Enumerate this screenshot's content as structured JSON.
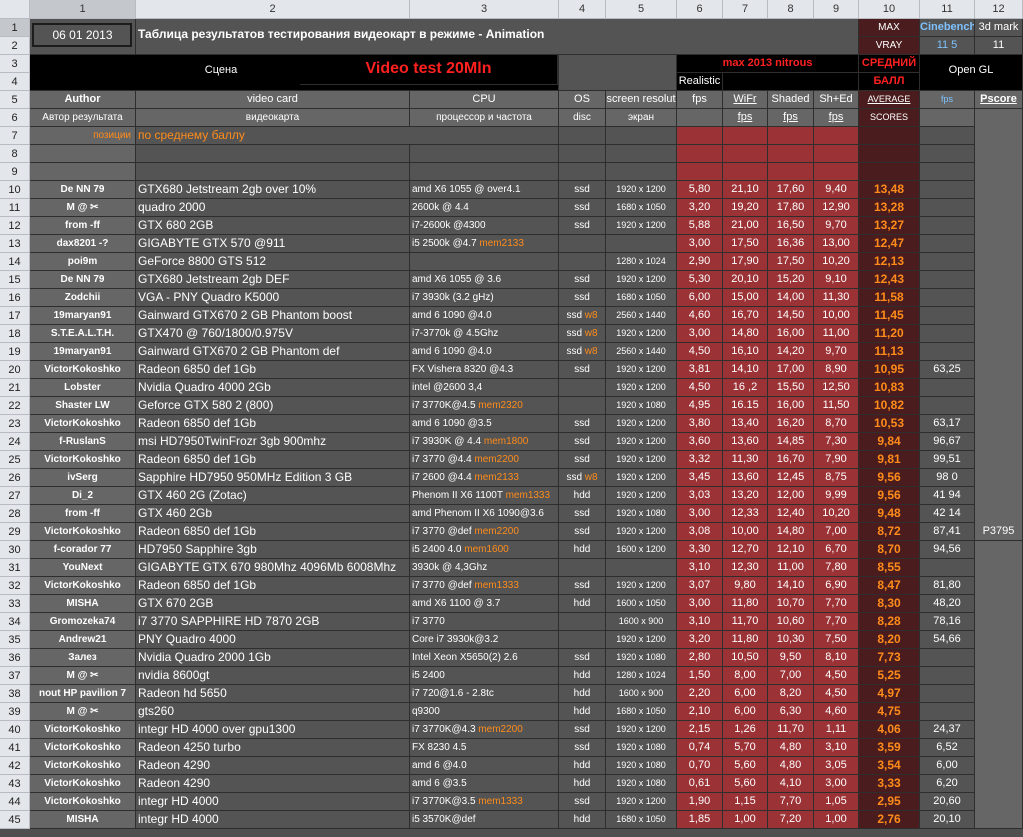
{
  "column_headers": [
    "1",
    "2",
    "3",
    "4",
    "5",
    "6",
    "7",
    "8",
    "9",
    "10",
    "11",
    "12"
  ],
  "row_numbers": [
    "1",
    "2",
    "3",
    "4",
    "5",
    "6",
    "7",
    "8",
    "9",
    "10",
    "11",
    "12",
    "13",
    "14",
    "15",
    "16",
    "17",
    "18",
    "19",
    "20",
    "21",
    "22",
    "23",
    "24",
    "25",
    "26",
    "27",
    "28",
    "29",
    "30",
    "31",
    "32",
    "33",
    "34",
    "35",
    "36",
    "37",
    "38",
    "39",
    "40",
    "41",
    "42",
    "43",
    "44",
    "45"
  ],
  "header": {
    "date": "06 01 2013",
    "title": "Таблица результатов тестирования видеокарт в режиме - Animation",
    "max_vray_1": "MAX",
    "max_vray_2": "VRAY",
    "cinebench_1": "Cinebench",
    "cinebench_2": "11 5",
    "mark3d_1": "3d mark",
    "mark3d_2": "11",
    "scene": "Сцена",
    "video_test": "Video test 20Mln",
    "max2013": "max 2013 nitrous",
    "avg_score_1": "СРЕДНИЙ",
    "avg_score_2": "БАЛЛ",
    "opengl": "Open GL",
    "realistic": "Realistic",
    "author": "Author",
    "video_card": "video card",
    "cpu": "CPU",
    "os": "OS",
    "screen_res": "screen resolut",
    "fps": "fps",
    "wifr": "WiFr",
    "shaded": "Shaded",
    "sh_ed": "Sh+Ed",
    "average": "AVERAGE",
    "fps11": "fps",
    "pscore": "Pscore",
    "author_ru": "Автор результата",
    "video_card_ru": "видеокарта",
    "cpu_ru": "процессор и частота",
    "disc": "disc",
    "screen_ru": "экран",
    "fps2": "fps",
    "fps3": "fps",
    "fps4": "fps",
    "scores": "SCORES",
    "positions": "позиции",
    "by_avg": "по среднему баллу"
  },
  "rows": [
    {
      "author": "De NN 79",
      "card": "GTX680 Jetstream 2gb over 10%",
      "cpu": "amd X6 1055 @ over4.1",
      "mem": "",
      "disc": "ssd",
      "w8": "",
      "res": "1920 x 1200",
      "real": "5,80",
      "wifr": "21,10",
      "shaded": "17,60",
      "shed": "9,40",
      "avg": "13,48",
      "cine": "",
      "pscore": ""
    },
    {
      "author": "M @ ✂",
      "card": "quadro 2000",
      "cpu": "2600k @ 4.4",
      "mem": "",
      "disc": "ssd",
      "w8": "",
      "res": "1680 x 1050",
      "real": "3,20",
      "wifr": "19,20",
      "shaded": "17,80",
      "shed": "12,90",
      "avg": "13,28",
      "cine": "",
      "pscore": ""
    },
    {
      "author": "from -ff",
      "card": "GTX 680 2GB",
      "cpu": "i7-2600k @4300",
      "mem": "",
      "disc": "ssd",
      "w8": "",
      "res": "1920 x 1200",
      "real": "5,88",
      "wifr": "21,00",
      "shaded": "16,50",
      "shed": "9,70",
      "avg": "13,27",
      "cine": "",
      "pscore": ""
    },
    {
      "author": "dax8201 -?",
      "card": "GIGABYTE GTX 570 @911",
      "cpu": "i5 2500k @4.7",
      "mem": "mem2133",
      "disc": "",
      "w8": "",
      "res": "",
      "real": "3,00",
      "wifr": "17,50",
      "shaded": "16,36",
      "shed": "13,00",
      "avg": "12,47",
      "cine": "",
      "pscore": ""
    },
    {
      "author": "poi9m",
      "card": "GeForce 8800 GTS 512",
      "cpu": "",
      "mem": "",
      "disc": "",
      "w8": "",
      "res": "1280 x 1024",
      "real": "2,90",
      "wifr": "17,90",
      "shaded": "17,50",
      "shed": "10,20",
      "avg": "12,13",
      "cine": "",
      "pscore": ""
    },
    {
      "author": "De NN 79",
      "card": "GTX680 Jetstream 2gb DEF",
      "cpu": "amd X6 1055 @ 3.6",
      "mem": "",
      "disc": "ssd",
      "w8": "",
      "res": "1920 x 1200",
      "real": "5,30",
      "wifr": "20,10",
      "shaded": "15,20",
      "shed": "9,10",
      "avg": "12,43",
      "cine": "",
      "pscore": ""
    },
    {
      "author": "Zodchii",
      "card": "VGA - PNY Quadro K5000",
      "cpu": "i7 3930k (3.2 gHz)",
      "mem": "",
      "disc": "ssd",
      "w8": "",
      "res": "1680 x 1050",
      "real": "6,00",
      "wifr": "15,00",
      "shaded": "14,00",
      "shed": "11,30",
      "avg": "11,58",
      "cine": "",
      "pscore": ""
    },
    {
      "author": "19maryan91",
      "card": "Gainward GTX670 2 GB Phantom boost",
      "cpu": "amd 6 1090 @4.0",
      "mem": "",
      "disc": "ssd",
      "w8": "w8",
      "res": "2560 x 1440",
      "real": "4,60",
      "wifr": "16,70",
      "shaded": "14,50",
      "shed": "10,00",
      "avg": "11,45",
      "cine": "",
      "pscore": ""
    },
    {
      "author": "S.T.E.A.L.T.H.",
      "card": "GTX470 @ 760/1800/0.975V",
      "cpu": "i7-3770k @ 4.5Ghz",
      "mem": "",
      "disc": "ssd",
      "w8": "w8",
      "res": "1920 x 1200",
      "real": "3,00",
      "wifr": "14,80",
      "shaded": "16,00",
      "shed": "11,00",
      "avg": "11,20",
      "cine": "",
      "pscore": ""
    },
    {
      "author": "19maryan91",
      "card": "Gainward GTX670 2 GB Phantom def",
      "cpu": "amd 6 1090 @4.0",
      "mem": "",
      "disc": "ssd",
      "w8": "w8",
      "res": "2560 x 1440",
      "real": "4,50",
      "wifr": "16,10",
      "shaded": "14,20",
      "shed": "9,70",
      "avg": "11,13",
      "cine": "",
      "pscore": ""
    },
    {
      "author": "VictorKokoshko",
      "card": "Radeon 6850 def 1Gb",
      "cpu": "FX Vishera 8320 @4.3",
      "mem": "",
      "disc": "ssd",
      "w8": "",
      "res": "1920 x 1200",
      "real": "3,81",
      "wifr": "14,10",
      "shaded": "17,00",
      "shed": "8,90",
      "avg": "10,95",
      "cine": "63,25",
      "pscore": ""
    },
    {
      "author": "Lobster",
      "card": "Nvidia Quadro 4000 2Gb",
      "cpu": "intel @2600 3,4",
      "mem": "",
      "disc": "",
      "w8": "",
      "res": "1920 x 1200",
      "real": "4,50",
      "wifr": "16 ,2",
      "shaded": "15,50",
      "shed": "12,50",
      "avg": "10,83",
      "cine": "",
      "pscore": ""
    },
    {
      "author": "Shaster LW",
      "card": "Geforce GTX 580 2 (800)",
      "cpu": "i7 3770K@4.5",
      "mem": "mem2320",
      "disc": "",
      "w8": "",
      "res": "1920 x 1080",
      "real": "4,95",
      "wifr": "16.15",
      "shaded": "16,00",
      "shed": "11,50",
      "avg": "10,82",
      "cine": "",
      "pscore": ""
    },
    {
      "author": "VictorKokoshko",
      "card": "Radeon 6850 def 1Gb",
      "cpu": "amd 6 1090 @3.5",
      "mem": "",
      "disc": "ssd",
      "w8": "",
      "res": "1920 x 1200",
      "real": "3,80",
      "wifr": "13,40",
      "shaded": "16,20",
      "shed": "8,70",
      "avg": "10,53",
      "cine": "63,17",
      "pscore": ""
    },
    {
      "author": "f-RuslanS",
      "card": "msi HD7950TwinFrozr 3gb 900mhz",
      "cpu": "i7 3930K @ 4.4",
      "mem": "mem1800",
      "disc": "ssd",
      "w8": "",
      "res": "1920 x 1200",
      "real": "3,60",
      "wifr": "13,60",
      "shaded": "14,85",
      "shed": "7,30",
      "avg": "9,84",
      "cine": "96,67",
      "pscore": ""
    },
    {
      "author": "VictorKokoshko",
      "card": "Radeon 6850 def 1Gb",
      "cpu": "i7 3770 @4.4",
      "mem": "mem2200",
      "disc": "ssd",
      "w8": "",
      "res": "1920 x 1200",
      "real": "3,32",
      "wifr": "11,30",
      "shaded": "16,70",
      "shed": "7,90",
      "avg": "9,81",
      "cine": "99,51",
      "pscore": ""
    },
    {
      "author": "ivSerg",
      "card": "Sapphire HD7950 950MHz Edition 3 GB",
      "cpu": "i7 2600 @4.4",
      "mem": "mem2133",
      "disc": "ssd",
      "w8": "w8",
      "res": "1920 x 1200",
      "real": "3,45",
      "wifr": "13,60",
      "shaded": "12,45",
      "shed": "8,75",
      "avg": "9,56",
      "cine": "98 0",
      "pscore": ""
    },
    {
      "author": "Di_2",
      "card": "GTX 460 2G (Zotac)",
      "cpu": "Phenom II X6 1100T",
      "mem": "mem1333",
      "disc": "hdd",
      "w8": "",
      "res": "1920 x 1200",
      "real": "3,03",
      "wifr": "13,20",
      "shaded": "12,00",
      "shed": "9,99",
      "avg": "9,56",
      "cine": "41 94",
      "pscore": ""
    },
    {
      "author": "from -ff",
      "card": "GTX 460 2Gb",
      "cpu": "amd Phenom II X6 1090@3.6",
      "mem": "",
      "disc": "ssd",
      "w8": "",
      "res": "1920 x 1080",
      "real": "3,00",
      "wifr": "12,33",
      "shaded": "12,40",
      "shed": "10,20",
      "avg": "9,48",
      "cine": "42 14",
      "pscore": ""
    },
    {
      "author": "VictorKokoshko",
      "card": "Radeon 6850 def 1Gb",
      "cpu": "i7 3770 @def",
      "mem": "mem2200",
      "disc": "ssd",
      "w8": "",
      "res": "1920 x 1200",
      "real": "3,08",
      "wifr": "10,00",
      "shaded": "14,80",
      "shed": "7,00",
      "avg": "8,72",
      "cine": "87,41",
      "pscore": "P3795"
    },
    {
      "author": "f-corador 77",
      "card": "HD7950 Sapphire 3gb",
      "cpu": "i5 2400 4.0",
      "mem": "mem1600",
      "disc": "hdd",
      "w8": "",
      "res": "1600 x 1200",
      "real": "3,30",
      "wifr": "12,70",
      "shaded": "12,10",
      "shed": "6,70",
      "avg": "8,70",
      "cine": "94,56",
      "pscore": ""
    },
    {
      "author": "YouNext",
      "card": "GIGABYTE GTX 670 980Mhz 4096Mb 6008Mhz",
      "cpu": "3930k @ 4,3Ghz",
      "mem": "",
      "disc": "",
      "w8": "",
      "res": "",
      "real": "3,10",
      "wifr": "12,30",
      "shaded": "11,00",
      "shed": "7,80",
      "avg": "8,55",
      "cine": "",
      "pscore": ""
    },
    {
      "author": "VictorKokoshko",
      "card": "Radeon 6850 def 1Gb",
      "cpu": "i7 3770 @def",
      "mem": "mem1333",
      "disc": "ssd",
      "w8": "",
      "res": "1920 x 1200",
      "real": "3,07",
      "wifr": "9,80",
      "shaded": "14,10",
      "shed": "6,90",
      "avg": "8,47",
      "cine": "81,80",
      "pscore": ""
    },
    {
      "author": "MISHA",
      "card": "GTX 670 2GB",
      "cpu": "amd X6 1100 @ 3.7",
      "mem": "",
      "disc": "hdd",
      "w8": "",
      "res": "1600 x 1050",
      "real": "3,00",
      "wifr": "11,80",
      "shaded": "10,70",
      "shed": "7,70",
      "avg": "8,30",
      "cine": "48,20",
      "pscore": ""
    },
    {
      "author": "Gromozeka74",
      "card": "i7 3770 SAPPHIRE HD 7870 2GB",
      "cpu": "i7 3770",
      "mem": "",
      "disc": "",
      "w8": "",
      "res": "1600 x 900",
      "real": "3,10",
      "wifr": "11,70",
      "shaded": "10,60",
      "shed": "7,70",
      "avg": "8,28",
      "cine": "78,16",
      "pscore": ""
    },
    {
      "author": "Andrew21",
      "card": "PNY Quadro 4000",
      "cpu": "Core i7 3930k@3.2",
      "mem": "",
      "disc": "",
      "w8": "",
      "res": "1920 x 1200",
      "real": "3,20",
      "wifr": "11,80",
      "shaded": "10,30",
      "shed": "7,50",
      "avg": "8,20",
      "cine": "54,66",
      "pscore": ""
    },
    {
      "author": "Залез",
      "card": "Nvidia Quadro 2000 1Gb",
      "cpu": "Intel Xeon X5650(2) 2.6",
      "mem": "",
      "disc": "ssd",
      "w8": "",
      "res": "1920 x 1080",
      "real": "2,80",
      "wifr": "10,50",
      "shaded": "9,50",
      "shed": "8,10",
      "avg": "7,73",
      "cine": "",
      "pscore": ""
    },
    {
      "author": "M @ ✂",
      "card": "nvidia 8600gt",
      "cpu": "i5 2400",
      "mem": "",
      "disc": "hdd",
      "w8": "",
      "res": "1280 x 1024",
      "real": "1,50",
      "wifr": "8,00",
      "shaded": "7,00",
      "shed": "4,50",
      "avg": "5,25",
      "cine": "",
      "pscore": ""
    },
    {
      "author": "nout HP pavilion 7",
      "card": "Radeon hd 5650",
      "cpu": "i7 720@1.6 - 2.8tc",
      "mem": "",
      "disc": "hdd",
      "w8": "",
      "res": "1600 x 900",
      "real": "2,20",
      "wifr": "6,00",
      "shaded": "8,20",
      "shed": "4,50",
      "avg": "4,97",
      "cine": "",
      "pscore": ""
    },
    {
      "author": "M @ ✂",
      "card": "gts260",
      "cpu": "q9300",
      "mem": "",
      "disc": "hdd",
      "w8": "",
      "res": "1680 x 1050",
      "real": "2,10",
      "wifr": "6,00",
      "shaded": "6,30",
      "shed": "4,60",
      "avg": "4,75",
      "cine": "",
      "pscore": ""
    },
    {
      "author": "VictorKokoshko",
      "card": "integr HD 4000 over gpu1300",
      "cpu": "i7 3770K@4.3",
      "mem": "mem2200",
      "disc": "ssd",
      "w8": "",
      "res": "1920 x 1200",
      "real": "2,15",
      "wifr": "1,26",
      "shaded": "11,70",
      "shed": "1,11",
      "avg": "4,06",
      "cine": "24,37",
      "pscore": ""
    },
    {
      "author": "VictorKokoshko",
      "card": "Radeon 4250 turbo",
      "cpu": "FX 8230 4.5",
      "mem": "",
      "disc": "ssd",
      "w8": "",
      "res": "1920 x 1080",
      "real": "0,74",
      "wifr": "5,70",
      "shaded": "4,80",
      "shed": "3,10",
      "avg": "3,59",
      "cine": "6,52",
      "pscore": ""
    },
    {
      "author": "VictorKokoshko",
      "card": "Radeon 4290",
      "cpu": "amd 6 @4.0",
      "mem": "",
      "disc": "hdd",
      "w8": "",
      "res": "1920 x 1080",
      "real": "0,70",
      "wifr": "5,60",
      "shaded": "4,80",
      "shed": "3,05",
      "avg": "3,54",
      "cine": "6,00",
      "pscore": ""
    },
    {
      "author": "VictorKokoshko",
      "card": "Radeon 4290",
      "cpu": "amd 6 @3.5",
      "mem": "",
      "disc": "hdd",
      "w8": "",
      "res": "1920 x 1080",
      "real": "0,61",
      "wifr": "5,60",
      "shaded": "4,10",
      "shed": "3,00",
      "avg": "3,33",
      "cine": "6,20",
      "pscore": ""
    },
    {
      "author": "VictorKokoshko",
      "card": "integr HD 4000",
      "cpu": "i7 3770K@3.5",
      "mem": "mem1333",
      "disc": "ssd",
      "w8": "",
      "res": "1920 x 1200",
      "real": "1,90",
      "wifr": "1,15",
      "shaded": "7,70",
      "shed": "1,05",
      "avg": "2,95",
      "cine": "20,60",
      "pscore": ""
    },
    {
      "author": "MISHA",
      "card": "integr HD 4000",
      "cpu": "i5 3570K@def",
      "mem": "",
      "disc": "hdd",
      "w8": "",
      "res": "1680 x 1050",
      "real": "1,85",
      "wifr": "1,00",
      "shaded": "7,20",
      "shed": "1,00",
      "avg": "2,76",
      "cine": "20,10",
      "pscore": ""
    }
  ]
}
